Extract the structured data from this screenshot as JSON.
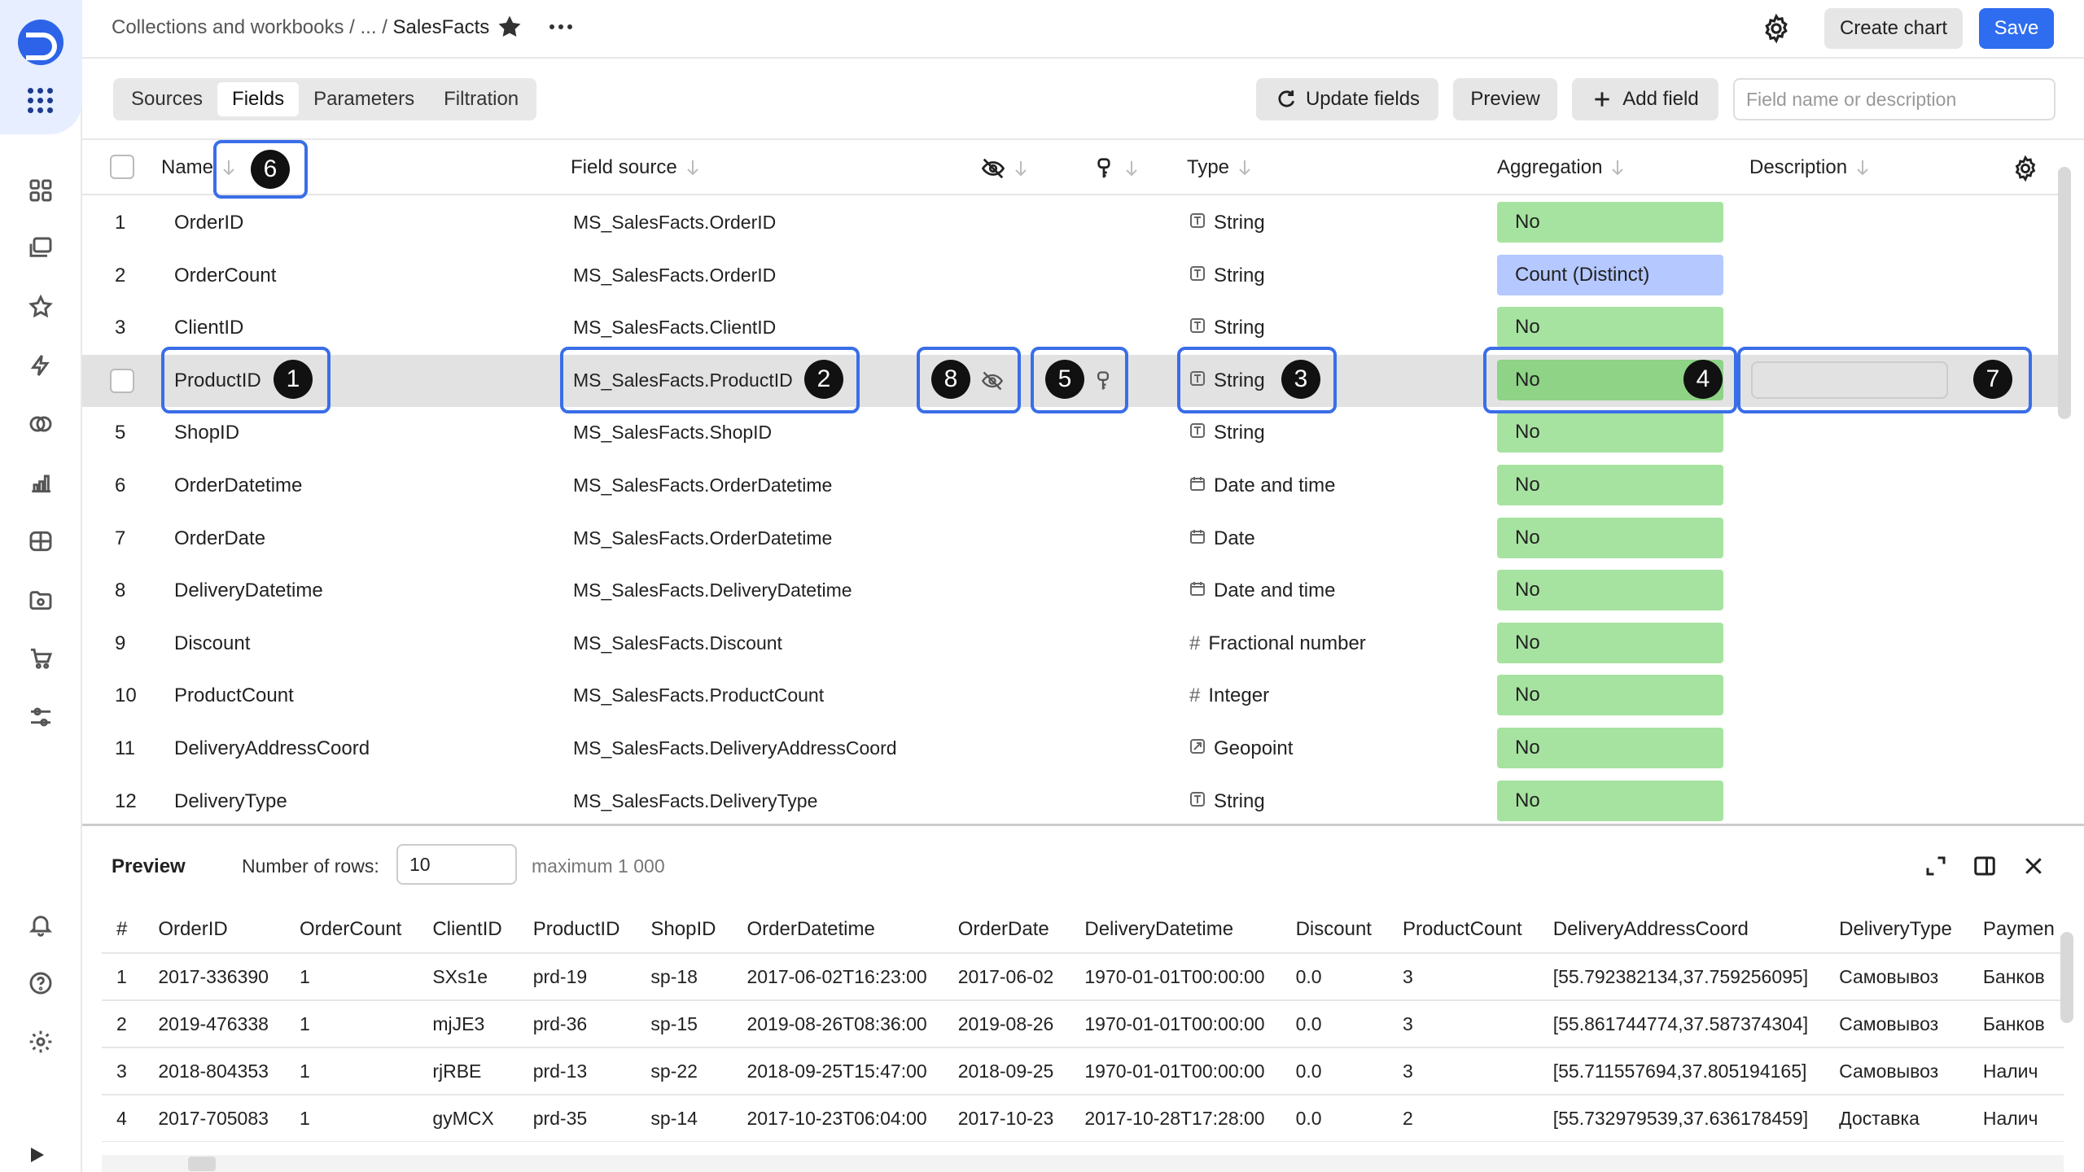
{
  "header": {
    "breadcrumb_root": "Collections and workbooks",
    "breadcrumb_sep1": "/",
    "breadcrumb_ellipsis": "...",
    "breadcrumb_sep2": "/",
    "breadcrumb_current": "SalesFacts",
    "create_chart": "Create chart",
    "save": "Save"
  },
  "tabs": [
    "Sources",
    "Fields",
    "Parameters",
    "Filtration"
  ],
  "active_tab": "Fields",
  "toolbar": {
    "update_fields": "Update fields",
    "preview": "Preview",
    "add_field": "Add field",
    "search_placeholder": "Field name or description"
  },
  "fields_columns": {
    "name": "Name",
    "source": "Field source",
    "type": "Type",
    "aggregation": "Aggregation",
    "description": "Description"
  },
  "fields": [
    {
      "num": "1",
      "name": "OrderID",
      "source": "MS_SalesFacts.OrderID",
      "type": "String",
      "type_icon": "string-icon",
      "agg": "No",
      "agg_color": "green"
    },
    {
      "num": "2",
      "name": "OrderCount",
      "source": "MS_SalesFacts.OrderID",
      "type": "String",
      "type_icon": "string-icon",
      "agg": "Count (Distinct)",
      "agg_color": "blue"
    },
    {
      "num": "3",
      "name": "ClientID",
      "source": "MS_SalesFacts.ClientID",
      "type": "String",
      "type_icon": "string-icon",
      "agg": "No",
      "agg_color": "green"
    },
    {
      "num": "",
      "name": "ProductID",
      "source": "MS_SalesFacts.ProductID",
      "type": "String",
      "type_icon": "string-icon",
      "agg": "No",
      "agg_color": "green",
      "selected": true
    },
    {
      "num": "5",
      "name": "ShopID",
      "source": "MS_SalesFacts.ShopID",
      "type": "String",
      "type_icon": "string-icon",
      "agg": "No",
      "agg_color": "green"
    },
    {
      "num": "6",
      "name": "OrderDatetime",
      "source": "MS_SalesFacts.OrderDatetime",
      "type": "Date and time",
      "type_icon": "calendar-icon",
      "agg": "No",
      "agg_color": "green"
    },
    {
      "num": "7",
      "name": "OrderDate",
      "source": "MS_SalesFacts.OrderDatetime",
      "type": "Date",
      "type_icon": "calendar-icon",
      "agg": "No",
      "agg_color": "green"
    },
    {
      "num": "8",
      "name": "DeliveryDatetime",
      "source": "MS_SalesFacts.DeliveryDatetime",
      "type": "Date and time",
      "type_icon": "calendar-icon",
      "agg": "No",
      "agg_color": "green"
    },
    {
      "num": "9",
      "name": "Discount",
      "source": "MS_SalesFacts.Discount",
      "type": "Fractional number",
      "type_icon": "hash-icon",
      "agg": "No",
      "agg_color": "green"
    },
    {
      "num": "10",
      "name": "ProductCount",
      "source": "MS_SalesFacts.ProductCount",
      "type": "Integer",
      "type_icon": "hash-icon",
      "agg": "No",
      "agg_color": "green"
    },
    {
      "num": "11",
      "name": "DeliveryAddressCoord",
      "source": "MS_SalesFacts.DeliveryAddressCoord",
      "type": "Geopoint",
      "type_icon": "geopoint-icon",
      "agg": "No",
      "agg_color": "green"
    },
    {
      "num": "12",
      "name": "DeliveryType",
      "source": "MS_SalesFacts.DeliveryType",
      "type": "String",
      "type_icon": "string-icon",
      "agg": "No",
      "agg_color": "green"
    }
  ],
  "callouts": [
    "1",
    "2",
    "3",
    "4",
    "5",
    "6",
    "7",
    "8"
  ],
  "preview": {
    "title": "Preview",
    "rows_label": "Number of rows:",
    "rows_value": "10",
    "max_label": "maximum 1 000",
    "columns": [
      "#",
      "OrderID",
      "OrderCount",
      "ClientID",
      "ProductID",
      "ShopID",
      "OrderDatetime",
      "OrderDate",
      "DeliveryDatetime",
      "Discount",
      "ProductCount",
      "DeliveryAddressCoord",
      "DeliveryType",
      "Paymen"
    ],
    "rows": [
      [
        "1",
        "2017-336390",
        "1",
        "SXs1e",
        "prd-19",
        "sp-18",
        "2017-06-02T16:23:00",
        "2017-06-02",
        "1970-01-01T00:00:00",
        "0.0",
        "3",
        "[55.792382134,37.759256095]",
        "Самовывоз",
        "Банков"
      ],
      [
        "2",
        "2019-476338",
        "1",
        "mjJE3",
        "prd-36",
        "sp-15",
        "2019-08-26T08:36:00",
        "2019-08-26",
        "1970-01-01T00:00:00",
        "0.0",
        "3",
        "[55.861744774,37.587374304]",
        "Самовывоз",
        "Банков"
      ],
      [
        "3",
        "2018-804353",
        "1",
        "rjRBE",
        "prd-13",
        "sp-22",
        "2018-09-25T15:47:00",
        "2018-09-25",
        "1970-01-01T00:00:00",
        "0.0",
        "3",
        "[55.711557694,37.805194165]",
        "Самовывоз",
        "Налич"
      ],
      [
        "4",
        "2017-705083",
        "1",
        "gyMCX",
        "prd-35",
        "sp-14",
        "2017-10-23T06:04:00",
        "2017-10-23",
        "2017-10-28T17:28:00",
        "0.0",
        "2",
        "[55.732979539,37.636178459]",
        "Доставка",
        "Налич"
      ]
    ]
  },
  "colors": {
    "accent": "#2f6df0",
    "agg_green": "#a7e3a0",
    "agg_blue": "#b5c8ff",
    "callout": "#3a6ee8"
  }
}
